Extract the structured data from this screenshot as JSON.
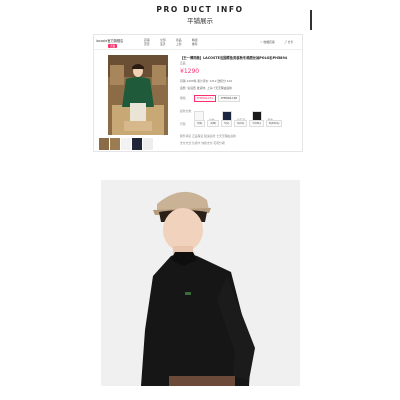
{
  "header": {
    "title": "PRO DUCT INFO",
    "subtitle": "平铺展示"
  },
  "store": {
    "name": "lacoste官方旗舰店",
    "badge": "天猫"
  },
  "nav": [
    {
      "top": "店铺",
      "bottom": "首页"
    },
    {
      "top": "全部",
      "bottom": "宝贝"
    },
    {
      "top": "新品",
      "bottom": "上新"
    },
    {
      "top": "精选",
      "bottom": "推荐"
    }
  ],
  "actions": {
    "favorite": "收藏店铺",
    "share": "分享"
  },
  "product": {
    "title": "【王一博同款】LACOSTE法国鳄鱼男装秋冬棉质长袖POLO衫PH5894",
    "tag": "正品",
    "price": "¥1290",
    "meta1": "月销 1290件   累计评价 1312   送积分 129",
    "meta2": "运费: 免运费   发货地: 上海   7天无理由退换"
  },
  "options": {
    "row1_label": "规格",
    "row1": [
      "PH5894-031",
      "PH5894-166"
    ],
    "color_label": "颜色分类",
    "colors": [
      "白色",
      "海军蓝",
      "黑色"
    ],
    "size_label": "尺码",
    "sizes": [
      "3(S)",
      "4(M)",
      "5(L)",
      "6(XL)",
      "7(XXL)",
      "8(XXXL)"
    ],
    "service1": "服务承诺  正品保证 极速退款 七天无理由退换",
    "service2": "支付方式  信用卡 快捷支付 花呗分期"
  }
}
